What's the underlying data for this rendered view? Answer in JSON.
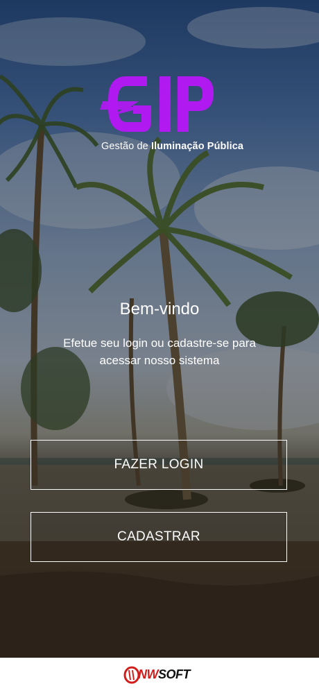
{
  "brand": {
    "logo_text": "GIP",
    "subtitle_prefix": "Gestão de ",
    "subtitle_bold": "Iluminação Pública",
    "accent_color": "#b019f0"
  },
  "welcome": {
    "title": "Bem-vindo",
    "message": "Efetue seu login ou cadastre-se para acessar nosso sistema"
  },
  "actions": {
    "login_label": "FAZER LOGIN",
    "signup_label": "CADASTRAR"
  },
  "footer": {
    "company_prefix": "NW",
    "company_suffix": "SOFT"
  }
}
